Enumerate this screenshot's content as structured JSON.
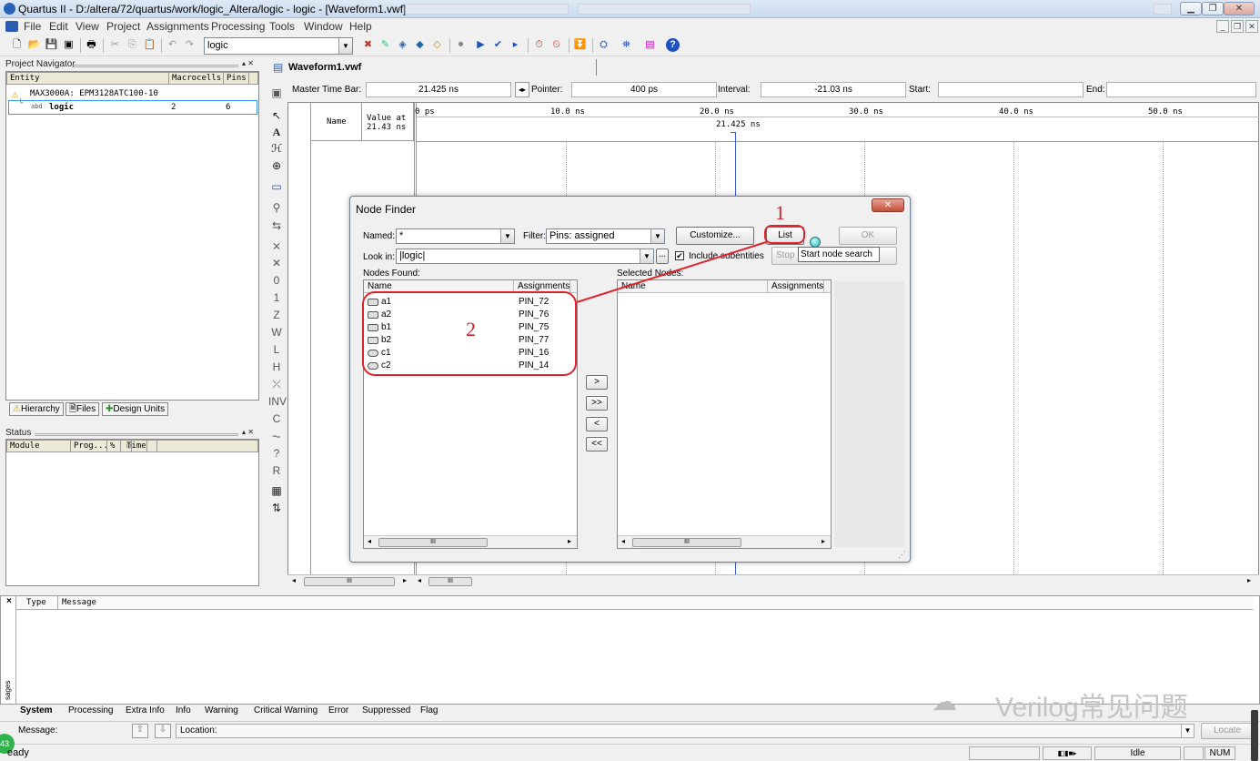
{
  "window": {
    "title": "Quartus II - D:/altera/72/quartus/work/logic_Altera/logic - logic - [Waveform1.vwf]"
  },
  "menu": [
    "File",
    "Edit",
    "View",
    "Project",
    "Assignments",
    "Processing",
    "Tools",
    "Window",
    "Help"
  ],
  "toolbar": {
    "project_combo": "logic"
  },
  "project_navigator": {
    "title": "Project Navigator",
    "columns": [
      "Entity",
      "Macrocells",
      "Pins"
    ],
    "device": "MAX3000A: EPM3128ATC100-10",
    "rows": [
      {
        "entity": "logic",
        "macrocells": "2",
        "pins": "6"
      }
    ],
    "tabs": [
      "Hierarchy",
      "Files",
      "Design Units"
    ]
  },
  "status_panel": {
    "title": "Status",
    "columns": [
      "Module",
      "Prog...",
      "%",
      "Time"
    ]
  },
  "waveform": {
    "tab": "Waveform1.vwf",
    "master_label": "Master Time Bar:",
    "master_value": "21.425 ns",
    "pointer_label": "Pointer:",
    "pointer_value": "400 ps",
    "interval_label": "Interval:",
    "interval_value": "-21.03 ns",
    "start_label": "Start:",
    "end_label": "End:",
    "name_col": "Name",
    "value_col_1": "Value at",
    "value_col_2": "21.43 ns",
    "marker": "21.425 ns",
    "ticks": [
      "0 ps",
      "10.0 ns",
      "20.0 ns",
      "30.0 ns",
      "40.0 ns",
      "50.0 ns"
    ]
  },
  "node_finder": {
    "title": "Node Finder",
    "named_label": "Named:",
    "named_value": "*",
    "filter_label": "Filter:",
    "filter_value": "Pins: assigned",
    "customize": "Customize...",
    "list": "List",
    "ok": "OK",
    "lookin_label": "Look in:",
    "lookin_value": "|logic|",
    "browse": "...",
    "include_sub": "Include subentities",
    "stop": "Stop",
    "tooltip": "Start node search",
    "nodes_found_label": "Nodes Found:",
    "selected_nodes_label": "Selected Nodes:",
    "name_col": "Name",
    "assign_col": "Assignments",
    "nodes": [
      {
        "name": "a1",
        "pin": "PIN_72"
      },
      {
        "name": "a2",
        "pin": "PIN_76"
      },
      {
        "name": "b1",
        "pin": "PIN_75"
      },
      {
        "name": "b2",
        "pin": "PIN_77"
      },
      {
        "name": "c1",
        "pin": "PIN_16"
      },
      {
        "name": "c2",
        "pin": "PIN_14"
      }
    ],
    "move_buttons": [
      ">",
      ">>",
      "<",
      "<<"
    ]
  },
  "annotations": {
    "one": "1",
    "two": "2"
  },
  "messages": {
    "type_col": "Type",
    "message_col": "Message",
    "tabs": [
      "System",
      "Processing",
      "Extra Info",
      "Info",
      "Warning",
      "Critical Warning",
      "Error",
      "Suppressed",
      "Flag"
    ],
    "message_label": "Message:",
    "location_label": "Location:",
    "locate": "Locate",
    "side_label": "sages"
  },
  "statusbar": {
    "ready": "eady",
    "idle": "Idle",
    "num": "NUM",
    "badge": "43"
  },
  "watermark": {
    "text": "Verilog常见问题"
  }
}
